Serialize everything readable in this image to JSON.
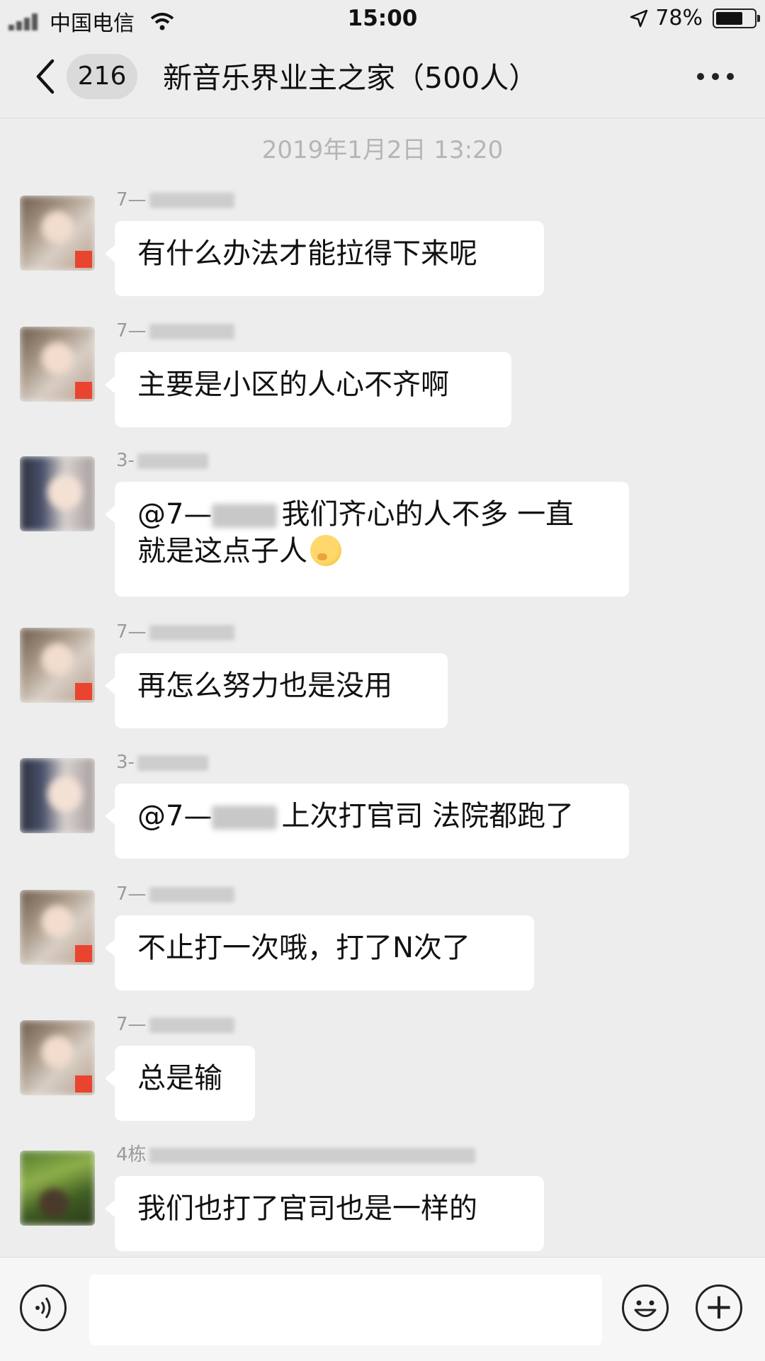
{
  "status_bar": {
    "carrier": "中国电信",
    "time": "15:00",
    "battery": "78%",
    "battery_level": 0.78
  },
  "nav": {
    "unread_count": "216",
    "title": "新音乐界业主之家（500人）"
  },
  "chat": {
    "timestamp": "2019年1月2日 13:20",
    "messages": [
      {
        "sender": "7—",
        "text": "有什么办法才能拉得下来呢"
      },
      {
        "sender": "7—",
        "text": "主要是小区的人心不齐啊"
      },
      {
        "sender": "3-",
        "mention": "@7—",
        "text_line1": "我们齐心的人不多 一直",
        "text_line2": "就是这点子人"
      },
      {
        "sender": "7—",
        "text": "再怎么努力也是没用"
      },
      {
        "sender": "3-",
        "mention": "@7—",
        "text": "上次打官司 法院都跑了"
      },
      {
        "sender": "7—",
        "text": "不止打一次哦，打了N次了"
      },
      {
        "sender": "7—",
        "text": "总是输"
      },
      {
        "sender": "4栋",
        "text": "我们也打了官司也是一样的"
      }
    ]
  },
  "input_bar": {
    "value": "",
    "icons": [
      "voice-icon",
      "emoji-icon",
      "plus-icon"
    ]
  }
}
